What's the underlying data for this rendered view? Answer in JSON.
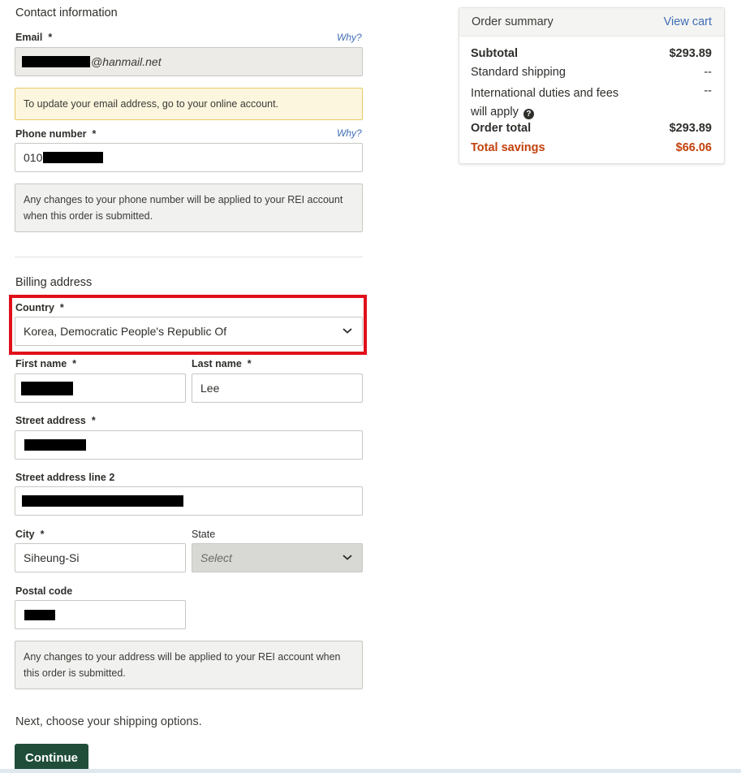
{
  "contact": {
    "title": "Contact information",
    "email_label": "Email",
    "required_mark": "*",
    "why_label": "Why?",
    "email_value": "@hanmail.net",
    "email_note": "To update your email address, go to your online account.",
    "phone_label": "Phone number",
    "phone_value": "010",
    "phone_note": "Any changes to your phone number will be applied to your REI account when this order is submitted."
  },
  "billing": {
    "title": "Billing address",
    "country_label": "Country",
    "country_value": "Korea, Democratic People's Republic Of",
    "first_name_label": "First name",
    "last_name_label": "Last name",
    "last_name_value": "Lee",
    "street_label": "Street address",
    "street2_label": "Street address line 2",
    "city_label": "City",
    "city_value": "Siheung-Si",
    "state_label": "State",
    "state_placeholder": "Select",
    "postal_label": "Postal code",
    "address_note": "Any changes to your address will be applied to your REI account when this order is submitted."
  },
  "next_text": "Next, choose your shipping options.",
  "continue_label": "Continue",
  "summary": {
    "title": "Order summary",
    "view_cart": "View cart",
    "subtotal_label": "Subtotal",
    "subtotal_value": "$293.89",
    "shipping_label": "Standard shipping",
    "shipping_value": "--",
    "duties_label_1": "International duties and fees",
    "duties_label_2": "will apply",
    "duties_value": "--",
    "help_glyph": "?",
    "total_label": "Order total",
    "total_value": "$293.89",
    "savings_label": "Total savings",
    "savings_value": "$66.06"
  },
  "colors": {
    "accent_green": "#1f4d3a",
    "link_blue": "#406eb5",
    "savings_red": "#c2410c",
    "highlight_red": "#e0101a"
  },
  "icons": [
    "chevron-down-icon",
    "question-circle-icon"
  ]
}
